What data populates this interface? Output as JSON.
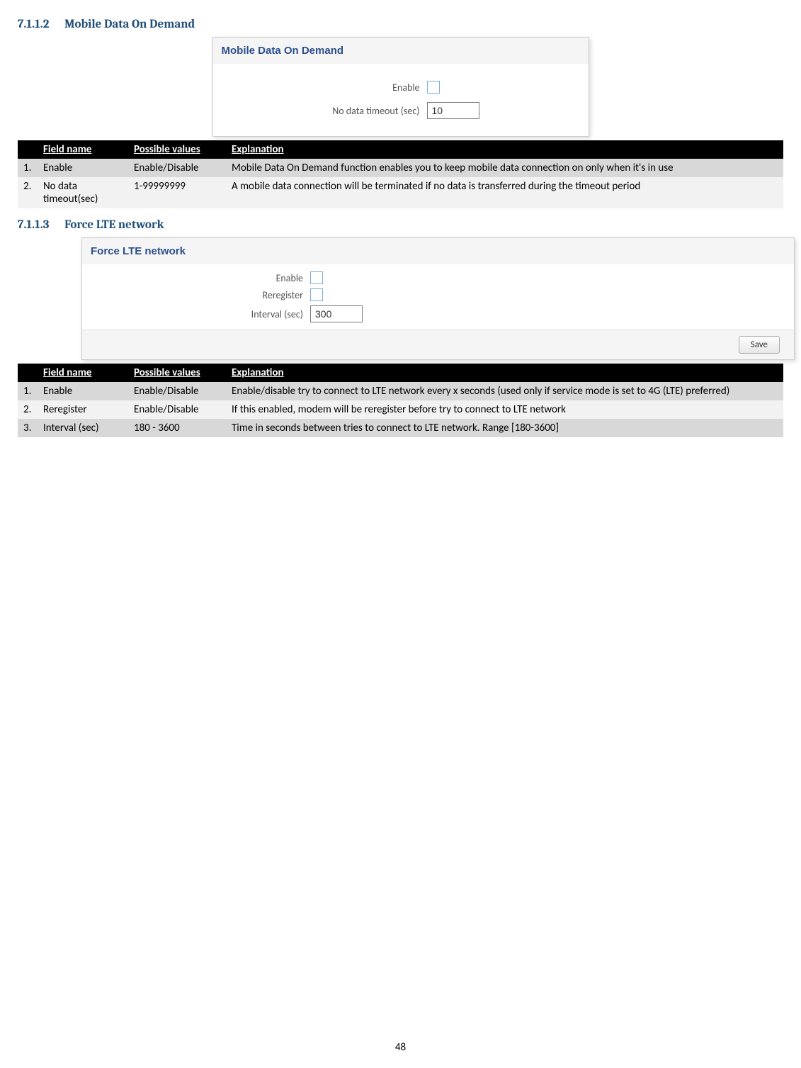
{
  "section1": {
    "number": "7.1.1.2",
    "title": "Mobile Data On Demand",
    "ui": {
      "title": "Mobile Data On Demand",
      "enable_label": "Enable",
      "timeout_label": "No data timeout (sec)",
      "timeout_value": "10"
    },
    "table": {
      "headers": {
        "num": "",
        "field": "Field name",
        "values": "Possible values",
        "explanation": "Explanation"
      },
      "rows": [
        {
          "n": "1.",
          "field": "Enable",
          "values": "Enable/Disable",
          "explanation": "Mobile Data On Demand function enables you to keep mobile data connection on only when it's in use"
        },
        {
          "n": "2.",
          "field": "No data timeout(sec)",
          "values": "1-99999999",
          "explanation": "A mobile data connection will be terminated if no data is transferred during the timeout period"
        }
      ]
    }
  },
  "section2": {
    "number": "7.1.1.3",
    "title": "Force LTE network",
    "ui": {
      "title": "Force LTE network",
      "enable_label": "Enable",
      "reregister_label": "Reregister",
      "interval_label": "Interval (sec)",
      "interval_value": "300",
      "save_label": "Save"
    },
    "table": {
      "headers": {
        "num": "",
        "field": "Field name",
        "values": "Possible values",
        "explanation": "Explanation"
      },
      "rows": [
        {
          "n": "1.",
          "field": "Enable",
          "values": "Enable/Disable",
          "explanation": "Enable/disable try to connect to LTE network every x seconds (used only if service mode is set to 4G (LTE) preferred)"
        },
        {
          "n": "2.",
          "field": "Reregister",
          "values": "Enable/Disable",
          "explanation": "If this enabled, modem will be reregister before try to connect to LTE network"
        },
        {
          "n": "3.",
          "field": "Interval (sec)",
          "values": "180 - 3600",
          "explanation": "Time in seconds between tries to connect to LTE network. Range [180-3600]"
        }
      ]
    }
  },
  "page_number": "48"
}
